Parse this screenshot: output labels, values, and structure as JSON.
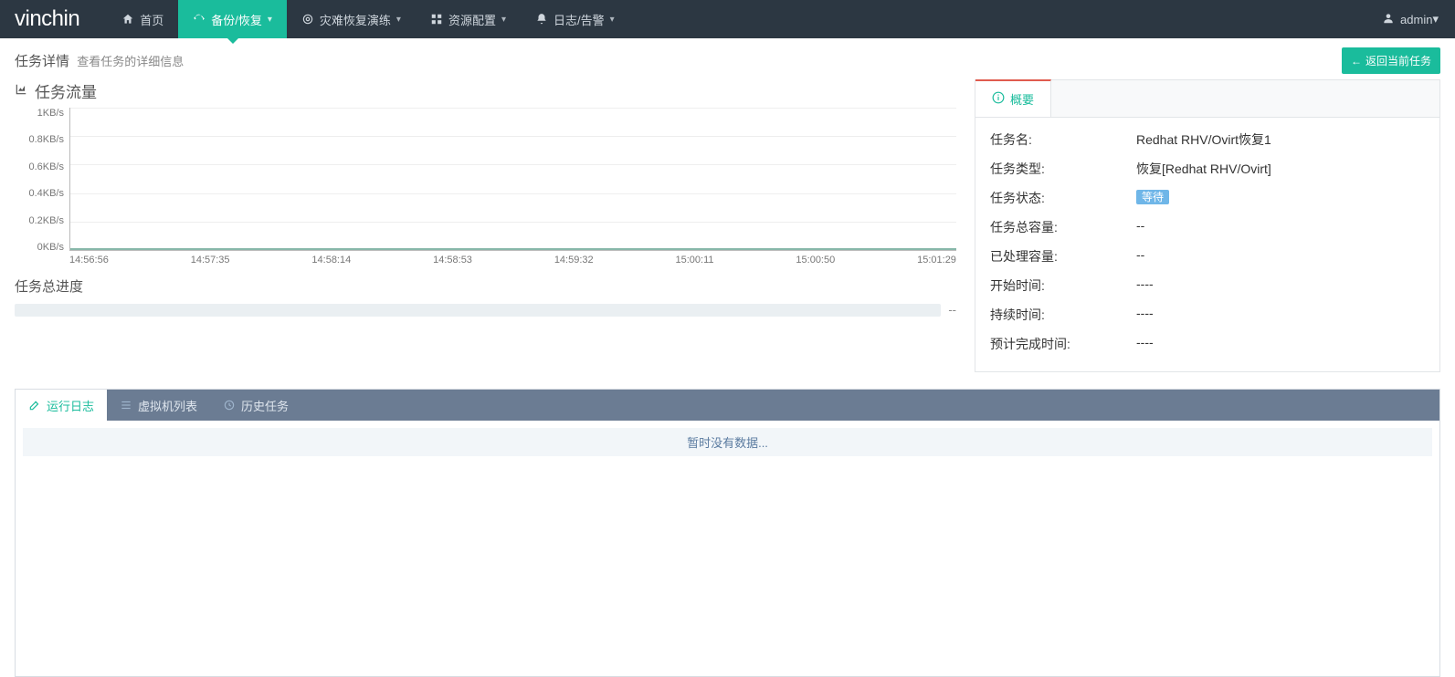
{
  "brand": "vinchin",
  "nav": {
    "items": [
      {
        "icon": "home-icon",
        "label": "首页",
        "hasDropdown": false,
        "active": false
      },
      {
        "icon": "refresh-icon",
        "label": "备份/恢复",
        "hasDropdown": true,
        "active": true
      },
      {
        "icon": "target-icon",
        "label": "灾难恢复演练",
        "hasDropdown": true,
        "active": false
      },
      {
        "icon": "grid-icon",
        "label": "资源配置",
        "hasDropdown": true,
        "active": false
      },
      {
        "icon": "bell-icon",
        "label": "日志/告警",
        "hasDropdown": true,
        "active": false
      }
    ],
    "user": {
      "icon": "user-icon",
      "name": "admin"
    }
  },
  "page": {
    "title": "任务详情",
    "subtitle": "查看任务的详细信息",
    "back_button": "返回当前任务"
  },
  "chart": {
    "title": "任务流量",
    "y_ticks": [
      "1KB/s",
      "0.8KB/s",
      "0.6KB/s",
      "0.4KB/s",
      "0.2KB/s",
      "0KB/s"
    ],
    "x_ticks": [
      "14:56:56",
      "14:57:35",
      "14:58:14",
      "14:58:53",
      "14:59:32",
      "15:00:11",
      "15:00:50",
      "15:01:29"
    ]
  },
  "chart_data": {
    "type": "line",
    "title": "任务流量",
    "xlabel": "",
    "ylabel": "",
    "y_unit": "KB/s",
    "ylim": [
      0,
      1
    ],
    "categories": [
      "14:56:56",
      "14:57:35",
      "14:58:14",
      "14:58:53",
      "14:59:32",
      "15:00:11",
      "15:00:50",
      "15:01:29"
    ],
    "series": [
      {
        "name": "throughput",
        "values": [
          0,
          0,
          0,
          0,
          0,
          0,
          0,
          0
        ]
      }
    ]
  },
  "progress": {
    "title": "任务总进度",
    "value_text": "--"
  },
  "summary": {
    "tab_label": "概要",
    "rows": [
      {
        "label": "任务名:",
        "value": "Redhat RHV/Ovirt恢复1"
      },
      {
        "label": "任务类型:",
        "value": "恢复[Redhat RHV/Ovirt]"
      },
      {
        "label": "任务状态:",
        "value": "等待",
        "badge": true
      },
      {
        "label": "任务总容量:",
        "value": "--"
      },
      {
        "label": "已处理容量:",
        "value": "--"
      },
      {
        "label": "开始时间:",
        "value": "----"
      },
      {
        "label": "持续时间:",
        "value": "----"
      },
      {
        "label": "预计完成时间:",
        "value": "----"
      }
    ]
  },
  "bottom": {
    "tabs": [
      {
        "icon": "edit-icon",
        "label": "运行日志",
        "active": true
      },
      {
        "icon": "list-icon",
        "label": "虚拟机列表",
        "active": false
      },
      {
        "icon": "history-icon",
        "label": "历史任务",
        "active": false
      }
    ],
    "empty_text": "暂时没有数据..."
  }
}
